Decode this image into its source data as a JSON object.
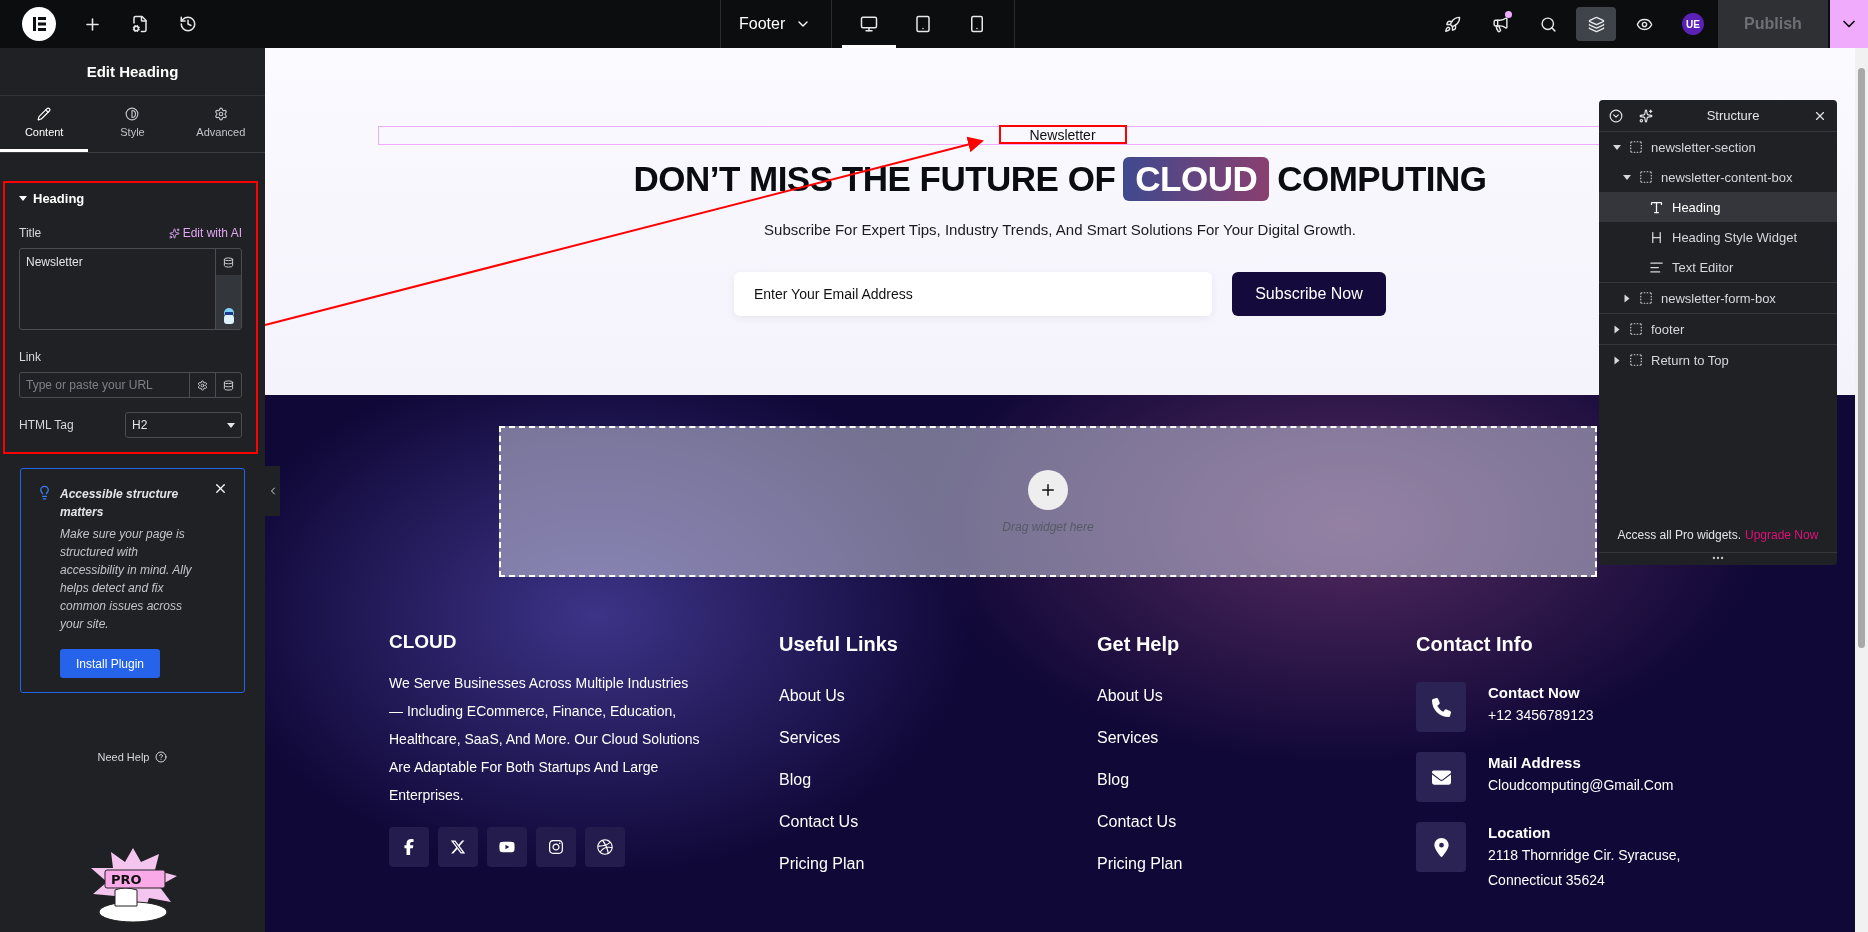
{
  "topbar": {
    "left_tools": [
      {
        "kind": "add"
      },
      {
        "kind": "page-settings"
      },
      {
        "kind": "history"
      }
    ],
    "page_selector": "Footer",
    "devices": [
      {
        "kind": "desktop",
        "selected": true
      },
      {
        "kind": "tablet",
        "selected": false
      },
      {
        "kind": "mobile",
        "selected": false
      }
    ],
    "right_tools": [
      {
        "kind": "launch",
        "selected": false,
        "notified": false
      },
      {
        "kind": "announcements",
        "selected": false,
        "notified": true
      },
      {
        "kind": "search",
        "selected": false,
        "notified": false
      },
      {
        "kind": "structure",
        "selected": true,
        "notified": false
      },
      {
        "kind": "preview",
        "selected": false,
        "notified": false
      }
    ],
    "avatar": "UE",
    "publish": {
      "label": "Publish",
      "disabled": true
    }
  },
  "panel": {
    "title": "Edit Heading",
    "tabs": [
      {
        "label": "Content",
        "kind": "content",
        "selected": true
      },
      {
        "label": "Style",
        "kind": "style",
        "selected": false
      },
      {
        "label": "Advanced",
        "kind": "advanced",
        "selected": false
      }
    ],
    "section": {
      "title": "Heading",
      "expanded": true,
      "title_field": {
        "label": "Title",
        "ai_link": "Edit with AI",
        "value": "Newsletter"
      },
      "link_field": {
        "label": "Link",
        "placeholder": "Type or paste your URL"
      },
      "tag_field": {
        "label": "HTML Tag",
        "value": "H2"
      }
    },
    "notice": {
      "title": "Accessible structure matters",
      "body": "Make sure your page is structured with accessibility in mind. Ally helps detect and fix common issues across your site.",
      "button": "Install Plugin"
    },
    "help": "Need Help",
    "mascot_badge": "PRO"
  },
  "canvas": {
    "newsletter": {
      "label": "Newsletter",
      "headline_before": "DON’T MISS THE FUTURE OF",
      "headline_highlight": "CLOUD",
      "headline_after": "COMPUTING",
      "subtitle": "Subscribe For Expert Tips, Industry Trends, And Smart Solutions For Your Digital Growth.",
      "email_placeholder": "Enter Your Email Address",
      "button": "Subscribe Now"
    },
    "drop_zone": "Drag widget here",
    "footer": {
      "brand": "CLOUD",
      "about": "We Serve Businesses Across Multiple Industries — Including ECommerce, Finance, Education, Healthcare, SaaS, And More. Our Cloud Solutions Are Adaptable For Both Startups And Large Enterprises.",
      "socials": [
        {
          "kind": "facebook"
        },
        {
          "kind": "x"
        },
        {
          "kind": "youtube"
        },
        {
          "kind": "instagram"
        },
        {
          "kind": "dribbble"
        }
      ],
      "columns": [
        {
          "title": "Useful Links",
          "links": [
            "About Us",
            "Services",
            "Blog",
            "Contact Us",
            "Pricing Plan"
          ]
        },
        {
          "title": "Get Help",
          "links": [
            "About Us",
            "Services",
            "Blog",
            "Contact Us",
            "Pricing Plan"
          ]
        }
      ],
      "contact": {
        "title": "Contact Info",
        "items": [
          {
            "kind": "phone",
            "title": "Contact Now",
            "lines": [
              "+12 3456789123"
            ]
          },
          {
            "kind": "mail",
            "title": "Mail Address",
            "lines": [
              "Cloudcomputing@Gmail.Com"
            ]
          },
          {
            "kind": "location",
            "title": "Location",
            "lines": [
              "2118 Thornridge Cir. Syracuse,",
              "Connecticut 35624"
            ]
          }
        ]
      }
    }
  },
  "structure": {
    "title": "Structure",
    "tree": [
      {
        "label": "newsletter-section",
        "kind": "container",
        "expanded": true,
        "selected": false,
        "children": [
          {
            "label": "newsletter-content-box",
            "kind": "container",
            "expanded": true,
            "selected": false,
            "children": [
              {
                "label": "Heading",
                "kind": "heading",
                "selected": true
              },
              {
                "label": "Heading Style Widget",
                "kind": "heading-style",
                "selected": false
              },
              {
                "label": "Text Editor",
                "kind": "text-editor",
                "selected": false
              }
            ]
          },
          {
            "label": "newsletter-form-box",
            "kind": "container",
            "expanded": false,
            "selected": false
          }
        ]
      },
      {
        "label": "footer",
        "kind": "container",
        "expanded": false,
        "selected": false
      },
      {
        "label": "Return to Top",
        "kind": "container",
        "expanded": false,
        "selected": false
      }
    ],
    "promo": "Access all Pro widgets.",
    "promo_link": "Upgrade Now"
  }
}
